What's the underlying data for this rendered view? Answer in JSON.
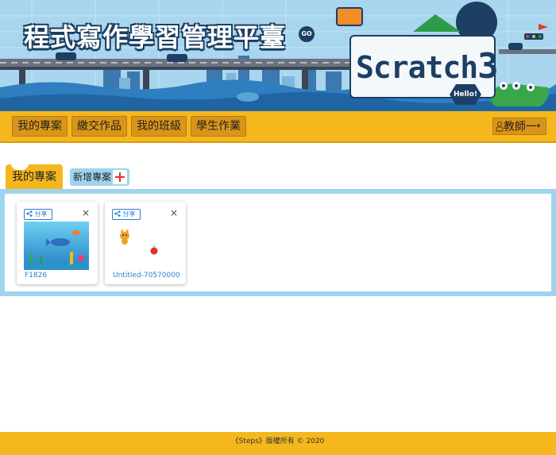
{
  "banner": {
    "site_title": "程式寫作學習管理平臺",
    "go_badge": "GO",
    "scratch_logo": "Scratch",
    "scratch_version": "3",
    "hello": "Hello!"
  },
  "nav": {
    "items": [
      {
        "label": "我的專案"
      },
      {
        "label": "繳交作品"
      },
      {
        "label": "我的班級"
      },
      {
        "label": "學生作業"
      }
    ],
    "user": {
      "label": "教師一",
      "icon": "person-icon"
    }
  },
  "tabs": {
    "active": "我的專案",
    "new_project": "新增專案"
  },
  "projects": [
    {
      "title": "F1826",
      "share_label": "分享",
      "close": "×"
    },
    {
      "title": "Untitled-70570000",
      "share_label": "分享",
      "close": "×"
    }
  ],
  "footer": {
    "text": "《Steps》版權所有 © 2020"
  },
  "colors": {
    "nav_bar": "#f4b81e",
    "nav_button": "#d9951a",
    "panel_border": "#9fd4ef",
    "link": "#2a7fd4",
    "banner_navy": "#1d3f63"
  }
}
